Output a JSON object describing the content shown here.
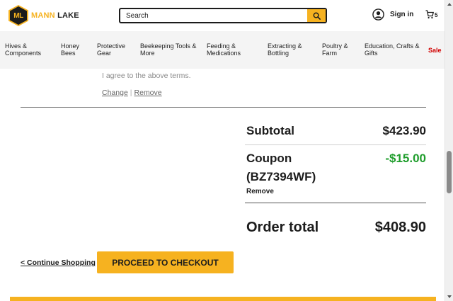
{
  "brand": {
    "logo_initials": "ML",
    "word_mann": "MANN",
    "word_lake": "LAKE",
    "accent_color": "#f6b220"
  },
  "search": {
    "placeholder": "Search",
    "value": "",
    "icon": "search-icon"
  },
  "account": {
    "signin_label": "Sign in",
    "icon": "user-circle-icon"
  },
  "cart": {
    "icon": "shopping-cart-icon",
    "count": "5"
  },
  "nav": {
    "items": [
      {
        "line1": "Hives &",
        "line2": "Components"
      },
      {
        "line1": "Honey",
        "line2": "Bees"
      },
      {
        "line1": "Protective",
        "line2": "Gear"
      },
      {
        "line1": "Beekeeping Tools &",
        "line2": "More"
      },
      {
        "line1": "Feeding &",
        "line2": "Medications"
      },
      {
        "line1": "Extracting &",
        "line2": "Bottling"
      },
      {
        "line1": "Poultry &",
        "line2": "Farm"
      },
      {
        "line1": "Education, Crafts &",
        "line2": "Gifts"
      }
    ],
    "sale": "Sale",
    "sale_color": "#d10000"
  },
  "item": {
    "terms_text": "I agree to the above terms.",
    "change_label": "Change",
    "separator": "|",
    "remove_label": "Remove"
  },
  "summary": {
    "subtotal_label": "Subtotal",
    "subtotal_value": "$423.90",
    "coupon_label": "Coupon",
    "coupon_code": "(BZ7394WF)",
    "coupon_value": "-$15.00",
    "coupon_color": "#1f9d2c",
    "coupon_remove": "Remove",
    "total_label": "Order total",
    "total_value": "$408.90"
  },
  "actions": {
    "continue_label": "< Continue Shopping",
    "checkout_label": "PROCEED TO CHECKOUT"
  }
}
